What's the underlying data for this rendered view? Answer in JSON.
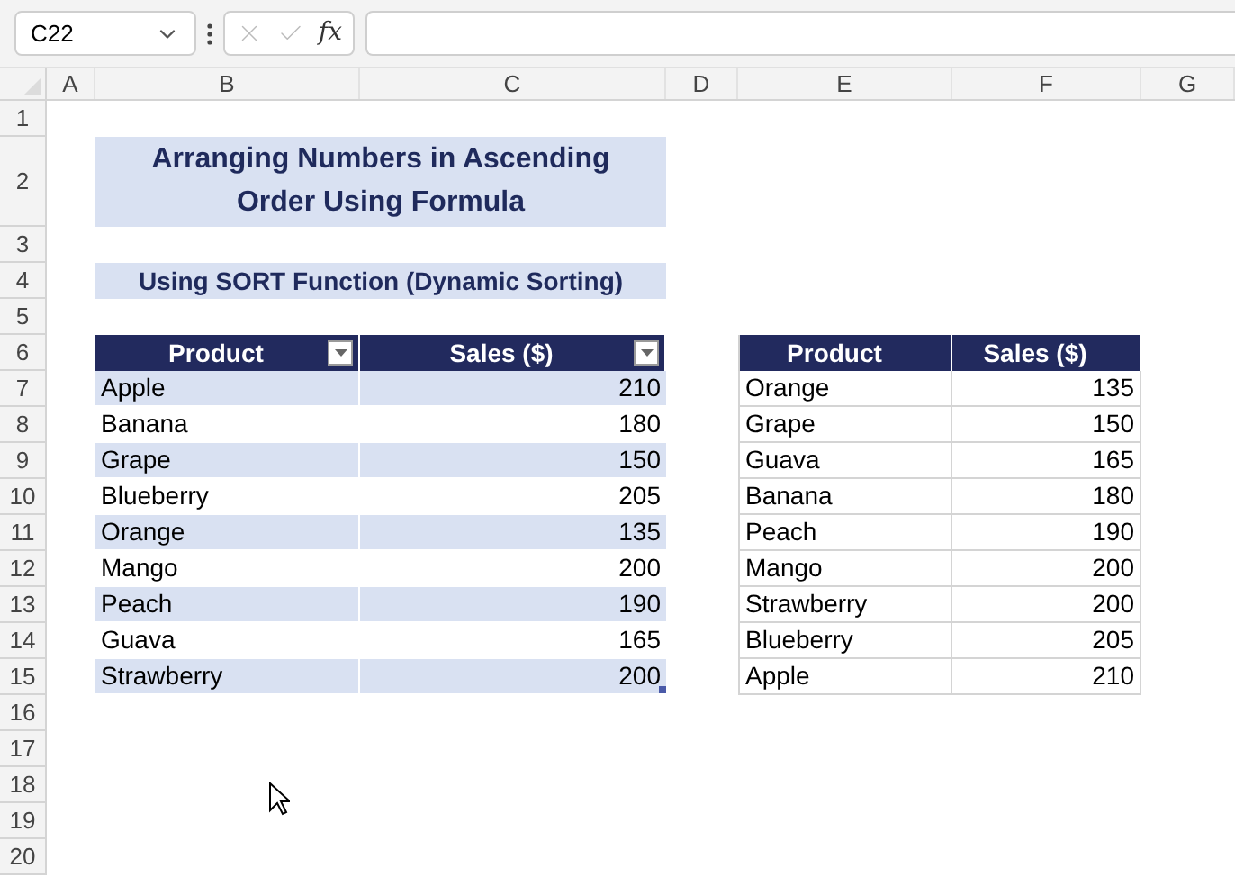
{
  "name_box": "C22",
  "formula_bar": {
    "function_label": "fx"
  },
  "columns": [
    "A",
    "B",
    "C",
    "D",
    "E",
    "F",
    "G"
  ],
  "rows": [
    "1",
    "2",
    "3",
    "4",
    "5",
    "6",
    "7",
    "8",
    "9",
    "10",
    "11",
    "12",
    "13",
    "14",
    "15",
    "16",
    "17",
    "18",
    "19",
    "20"
  ],
  "title": "Arranging Numbers in Ascending Order Using Formula",
  "subtitle": "Using SORT Function (Dynamic Sorting)",
  "source_table": {
    "columns": [
      {
        "label": "Product",
        "filter_button": true
      },
      {
        "label": "Sales ($)",
        "filter_button": true
      }
    ],
    "rows": [
      [
        "Apple",
        "210"
      ],
      [
        "Banana",
        "180"
      ],
      [
        "Grape",
        "150"
      ],
      [
        "Blueberry",
        "205"
      ],
      [
        "Orange",
        "135"
      ],
      [
        "Mango",
        "200"
      ],
      [
        "Peach",
        "190"
      ],
      [
        "Guava",
        "165"
      ],
      [
        "Strawberry",
        "200"
      ]
    ]
  },
  "sorted_table": {
    "columns": [
      {
        "label": "Product",
        "filter_button": false
      },
      {
        "label": "Sales ($)",
        "filter_button": false
      }
    ],
    "rows": [
      [
        "Orange",
        "135"
      ],
      [
        "Grape",
        "150"
      ],
      [
        "Guava",
        "165"
      ],
      [
        "Banana",
        "180"
      ],
      [
        "Peach",
        "190"
      ],
      [
        "Mango",
        "200"
      ],
      [
        "Strawberry",
        "200"
      ],
      [
        "Blueberry",
        "205"
      ],
      [
        "Apple",
        "210"
      ]
    ]
  }
}
